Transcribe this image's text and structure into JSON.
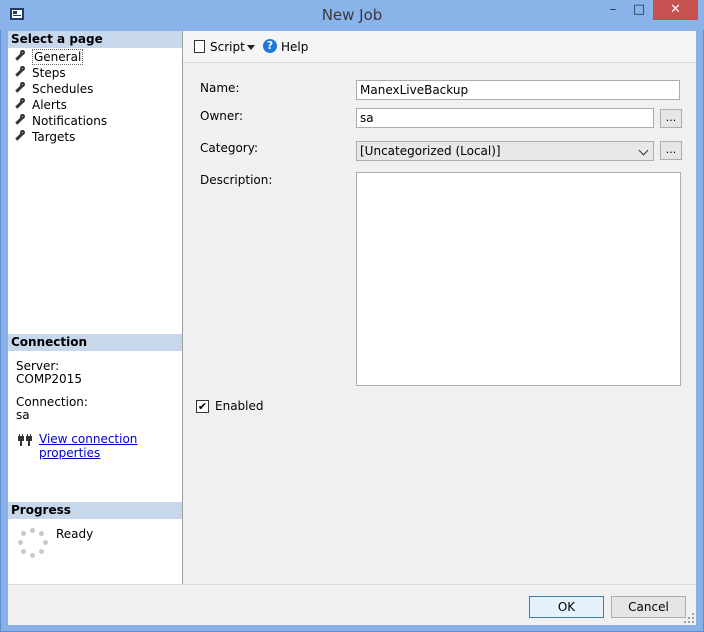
{
  "window": {
    "title": "New Job",
    "minimize": "–",
    "maximize": "□",
    "close": "✕"
  },
  "sidebar": {
    "select_page_header": "Select a page",
    "pages": [
      {
        "label": "General",
        "icon": "wrench-icon",
        "selected": true
      },
      {
        "label": "Steps",
        "icon": "wrench-icon"
      },
      {
        "label": "Schedules",
        "icon": "wrench-icon"
      },
      {
        "label": "Alerts",
        "icon": "wrench-icon"
      },
      {
        "label": "Notifications",
        "icon": "wrench-icon"
      },
      {
        "label": "Targets",
        "icon": "wrench-icon"
      }
    ],
    "connection": {
      "header": "Connection",
      "server_label": "Server:",
      "server_value": "COMP2015",
      "connection_label": "Connection:",
      "connection_value": "sa",
      "view_link": "View connection properties"
    },
    "progress": {
      "header": "Progress",
      "status": "Ready"
    }
  },
  "toolbar": {
    "script_label": "Script",
    "help_label": "Help"
  },
  "form": {
    "name_label": "Name:",
    "name_value": "ManexLiveBackup",
    "owner_label": "Owner:",
    "owner_value": "sa",
    "browse_label": "...",
    "category_label": "Category:",
    "category_value": "[Uncategorized (Local)]",
    "description_label": "Description:",
    "description_value": "",
    "enabled_label": "Enabled",
    "enabled_checked": true
  },
  "buttons": {
    "ok": "OK",
    "cancel": "Cancel"
  }
}
